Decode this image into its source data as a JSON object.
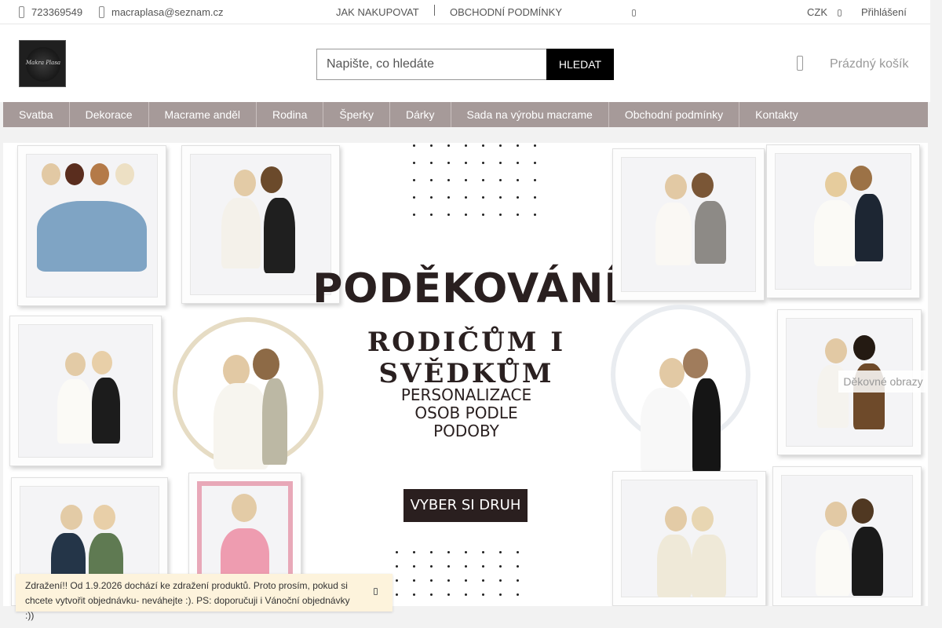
{
  "topbar": {
    "phone": "723369549",
    "email": "macraplasa@seznam.cz",
    "how_to_buy": "JAK NAKUPOVAT",
    "terms": "OBCHODNÍ PODMÍNKY",
    "currency": "CZK",
    "login": "Přihlášení"
  },
  "header": {
    "logo_text": "Makra Plasa",
    "search_placeholder": "Napište, co hledáte",
    "search_button": "HLEDAT",
    "cart_label": "Prázdný košík"
  },
  "nav": {
    "items": [
      {
        "label": "Svatba"
      },
      {
        "label": "Dekorace"
      },
      {
        "label": "Macrame anděl"
      },
      {
        "label": "Rodina"
      },
      {
        "label": "Šperky"
      },
      {
        "label": "Dárky"
      },
      {
        "label": "Sada na výrobu macrame"
      },
      {
        "label": "Obchodní podmínky"
      },
      {
        "label": "Kontakty"
      }
    ]
  },
  "banner": {
    "headline": "PODĚKOVÁNÍ",
    "subhead": "RODIČŮM I SVĚDKŮM",
    "perso_line1": "PERSONALIZACE",
    "perso_line2": "OSOB PODLE",
    "perso_line3": "PODOBY",
    "cta": "VYBER SI DRUH",
    "tag": "Děkovné obrazy"
  },
  "notice": {
    "line1": "Zdražení!! Od 1.9.2026 dochází ke zdražení produktů. Proto prosím, pokud si",
    "line2": "chcete vytvořit objednávku- neváhejte :). PS: doporučuji i Vánoční objednávky :))"
  }
}
